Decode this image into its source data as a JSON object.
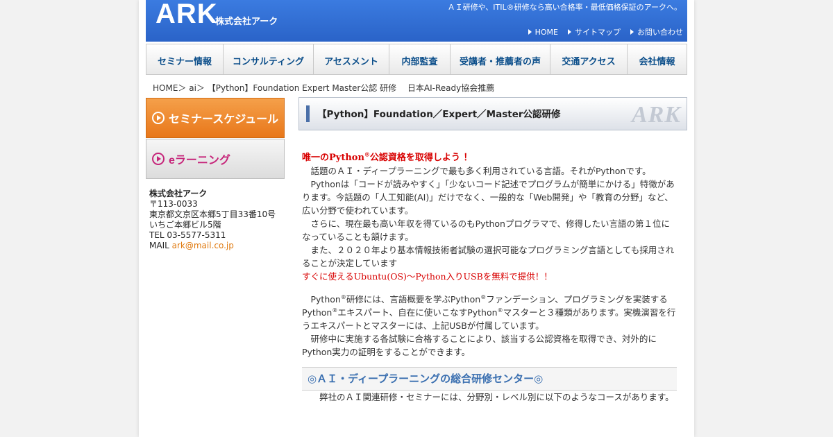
{
  "header": {
    "logo": "ARK",
    "logo_sub": "株式会社アーク",
    "tagline": "ＡＩ研修や、ITIL®研修なら高い合格率・最低価格保証のアークへ。",
    "links": [
      "HOME",
      "サイトマップ",
      "お問い合わせ"
    ]
  },
  "nav": {
    "items": [
      "セミナー情報",
      "コンサルティング",
      "アセスメント",
      "内部監査",
      "受講者・推薦者の声",
      "交通アクセス",
      "会社情報"
    ]
  },
  "breadcrumb": {
    "home": "HOME",
    "ai": "ai",
    "current": "【Python】Foundation Expert Master公認 研修　 日本AI-Ready協会推薦",
    "sep": "＞"
  },
  "sidebar": {
    "seminar_banner": "セミナースケジュール",
    "elearning_banner": "eラーニング",
    "company_name": "株式会社アーク",
    "postal": "〒113-0033",
    "address1": "東京都文京区本郷5丁目33番10号",
    "address2": "いちご本郷ビル5階",
    "tel": "TEL 03-5577-5311",
    "mail_label": "MAIL",
    "mail": "ark@mail.co.jp"
  },
  "title": {
    "text": "【Python】Foundation／Expert／Master公認研修",
    "watermark": "ARK"
  },
  "content": {
    "headline_pre": "唯一のPython",
    "headline_sup": "®",
    "headline_post": "公認資格を取得しよう ！",
    "p1": "　話題のＡＩ・ディープラーニングで最も多く利用されている言語。それがPythonです。",
    "p2": "　Pythonは「コードが読みやすく」「少ないコード記述でプログラムが簡単にかける」特徴があります。今話題の「人工知能(AI)」だけでなく、一般的な「Web開発」や「教育の分野」など、広い分野で使われています。",
    "p3": "　さらに、現在最も高い年収を得ているのもPythonプログラマで、修得したい言語の第１位になっていることも頷けます。",
    "p4": "　また、２０２０年より基本情報技術者試験の選択可能なプログラミング言語としても採用されることが決定しています",
    "usb_note": "すぐに使えるUbuntu(OS)～Python入りUSBを無料で提供！！",
    "p5_a": "　Python",
    "p5_b": "研修には、言語概要を学ぶPython",
    "p5_c": "ファンデーション、プログラミングを実装するPython",
    "p5_d": "エキスパート、自在に使いこなすPython",
    "p5_e": "マスターと３種類があります。実機演習を行うエキスパートとマスターには、上記USBが付属しています。",
    "reg": "®",
    "p6": "　研修中に実施する各試験に合格することにより、該当する公認資格を取得でき、対外的にPython実力の証明をすることができます。",
    "section_title": "◎ＡＩ・ディープラーニングの総合研修センター◎",
    "p7": "　　弊社のＡＩ関連研修・セミナーには、分野別・レベル別に以下のようなコースがあります。"
  },
  "colors": {
    "header_blue": "#2a63c8",
    "nav_text": "#0b4e8a",
    "orange": "#e8771a",
    "magenta": "#c6257a",
    "red": "#d80000",
    "section_blue": "#3a6fb0"
  }
}
